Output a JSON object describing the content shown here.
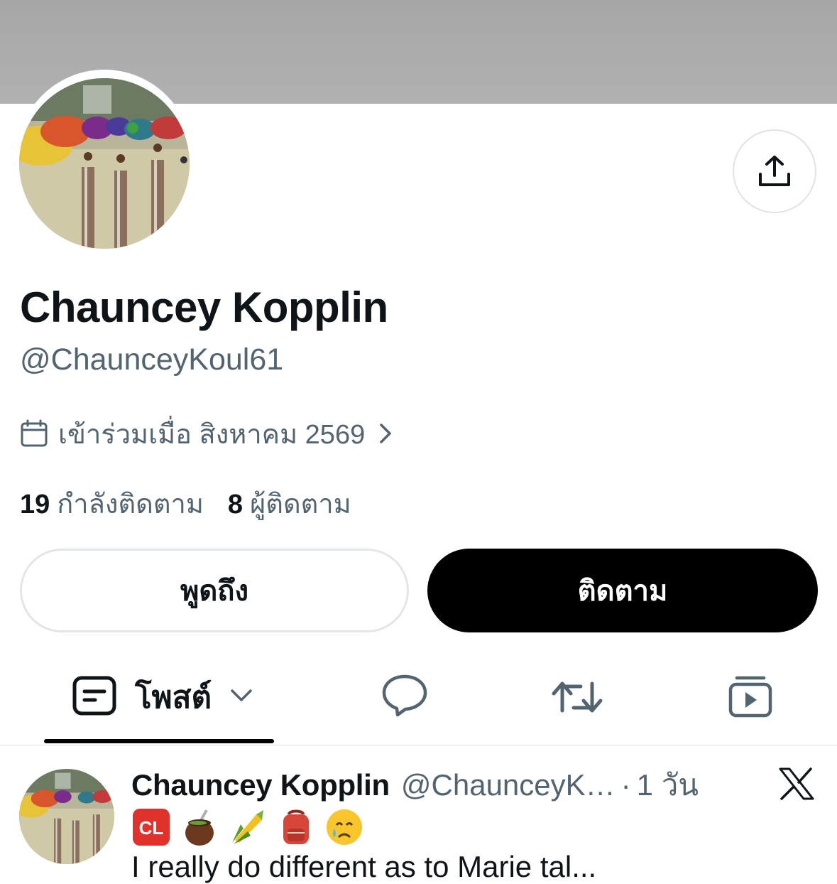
{
  "profile": {
    "name": "Chauncey Kopplin",
    "handle": "@ChaunceyKoul61",
    "joined": "เข้าร่วมเมื่อ สิงหาคม 2569",
    "following_count": "19",
    "following_label": "กำลังติดตาม",
    "followers_count": "8",
    "followers_label": "ผู้ติดตาม"
  },
  "icons": {
    "share": "share-upload-icon",
    "calendar": "calendar-icon",
    "chevron": "chevron-right-icon",
    "posts": "posts-icon",
    "replies": "speech-bubble-icon",
    "reposts": "repost-icon",
    "media": "media-play-icon",
    "x": "x-logo-icon"
  },
  "actions": {
    "mention_label": "พูดถึง",
    "follow_label": "ติดตาม"
  },
  "tabs": {
    "posts_label": "โพสต์"
  },
  "tweet": {
    "name": "Chauncey Kopplin",
    "handle": "@ChaunceyK…",
    "separator": "·",
    "time": "1 วัน",
    "emojis": [
      "CL",
      "mate-gourd",
      "corn",
      "backpack",
      "crying-face"
    ],
    "text": "I really do different as to Marie tal..."
  },
  "colors": {
    "text": "#0f1419",
    "secondary": "#536471",
    "border": "#e3e6e8",
    "follow_button": "#000000",
    "banner": "#aaaaaa",
    "cl_badge": "#e0322b"
  }
}
